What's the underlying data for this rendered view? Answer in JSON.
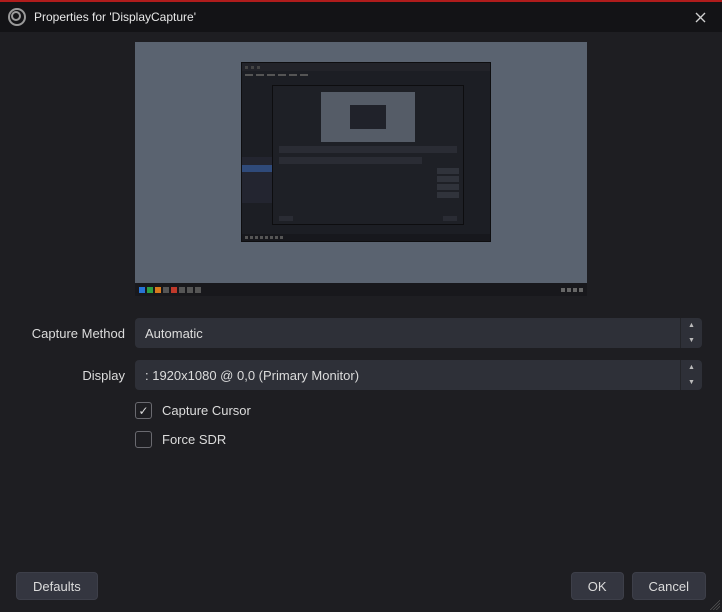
{
  "window": {
    "title": "Properties for 'DisplayCapture'"
  },
  "form": {
    "capture_method": {
      "label": "Capture Method",
      "value": "Automatic"
    },
    "display": {
      "label": "Display",
      "value": ": 1920x1080 @ 0,0 (Primary Monitor)"
    },
    "capture_cursor": {
      "label": "Capture Cursor",
      "checked": true
    },
    "force_sdr": {
      "label": "Force SDR",
      "checked": false
    }
  },
  "buttons": {
    "defaults": "Defaults",
    "ok": "OK",
    "cancel": "Cancel"
  }
}
